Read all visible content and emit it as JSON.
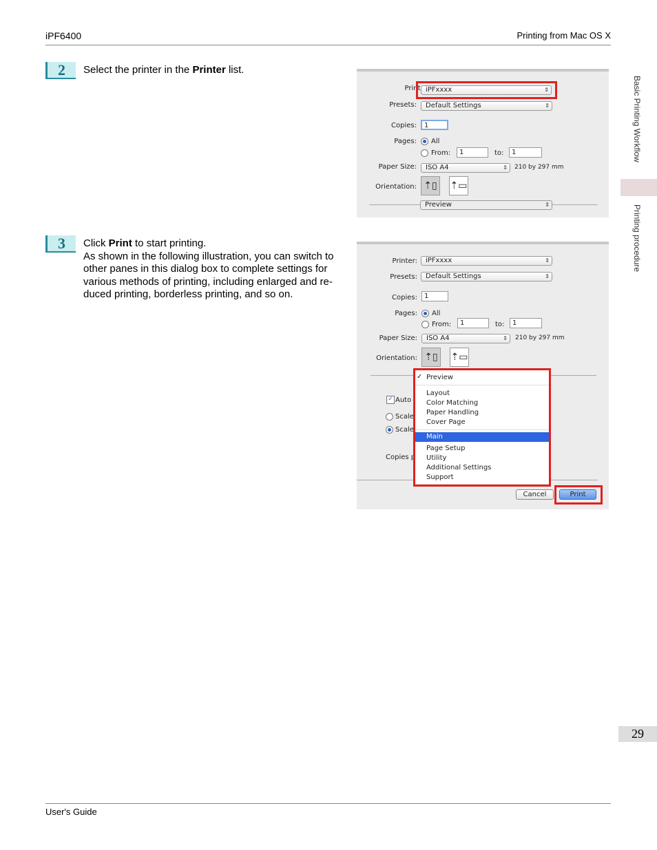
{
  "header": {
    "left": "iPF6400",
    "right": "Printing from Mac OS X"
  },
  "footer": {
    "left": "User's Guide",
    "page_number": "29"
  },
  "side_tabs": {
    "section": "Basic Printing Workflow",
    "subsection": "Printing procedure"
  },
  "steps": [
    {
      "number": "2",
      "text_before": "Select the printer in the ",
      "text_bold": "Printer",
      "text_after": " list."
    },
    {
      "number": "3",
      "text_before": "Click ",
      "text_bold": "Print",
      "text_after": " to start printing.",
      "paragraph": "As shown in the following illustration, you can switch to other panes in this dialog box to complete settings for various methods of printing, including enlarged and re-duced printing, borderless printing, and so on."
    }
  ],
  "dialog1": {
    "printer_label": "Printer:",
    "printer_value": "iPFxxxx",
    "presets_label": "Presets:",
    "presets_value": "Default Settings",
    "copies_label": "Copies:",
    "copies_value": "1",
    "pages_label": "Pages:",
    "pages_all": "All",
    "pages_from": "From:",
    "from_value": "1",
    "to_label": "to:",
    "to_value": "1",
    "paper_label": "Paper Size:",
    "paper_value": "ISO A4",
    "paper_dims": "210 by 297 mm",
    "orientation_label": "Orientation:",
    "pane_value": "Preview"
  },
  "dialog2": {
    "printer_label": "Printer:",
    "printer_value": "iPFxxxx",
    "presets_label": "Presets:",
    "presets_value": "Default Settings",
    "copies_label": "Copies:",
    "copies_value": "1",
    "pages_label": "Pages:",
    "pages_all": "All",
    "pages_from": "From:",
    "from_value": "1",
    "to_label": "to:",
    "to_value": "1",
    "paper_label": "Paper Size:",
    "paper_value": "ISO A4",
    "paper_dims": "210 by 297 mm",
    "orientation_label": "Orientation:",
    "bg_auto": "Auto",
    "bg_scale1": "Scale",
    "bg_scale2": "Scale",
    "bg_copies": "Copies p",
    "menu": {
      "checked": "Preview",
      "group1": [
        "Layout",
        "Color Matching",
        "Paper Handling",
        "Cover Page"
      ],
      "highlighted": "Main",
      "group2": [
        "Page Setup",
        "Utility",
        "Additional Settings",
        "Support"
      ]
    },
    "cancel_label": "Cancel",
    "print_label": "Print"
  },
  "colors": {
    "step_accent": "#2a8a9c",
    "highlight_box": "#e02020",
    "menu_selection": "#2f64e0"
  }
}
